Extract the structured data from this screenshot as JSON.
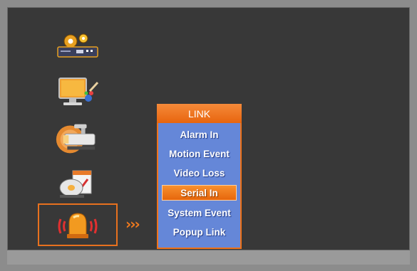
{
  "menu": {
    "header": "LINK",
    "items": [
      {
        "label": "Alarm In",
        "selected": false
      },
      {
        "label": "Motion Event",
        "selected": false
      },
      {
        "label": "Video Loss",
        "selected": false
      },
      {
        "label": "Serial In",
        "selected": true
      },
      {
        "label": "System Event",
        "selected": false
      },
      {
        "label": "Popup Link",
        "selected": false
      }
    ]
  },
  "nav": {
    "icons": [
      {
        "name": "system-settings-icon"
      },
      {
        "name": "display-icon"
      },
      {
        "name": "camera-icon"
      },
      {
        "name": "record-schedule-icon"
      },
      {
        "name": "alarm-light-icon",
        "selected": true
      }
    ],
    "arrows": "›››"
  },
  "colors": {
    "accent": "#f07218",
    "menu_bg": "#6587d8",
    "screen_bg": "#383838"
  }
}
